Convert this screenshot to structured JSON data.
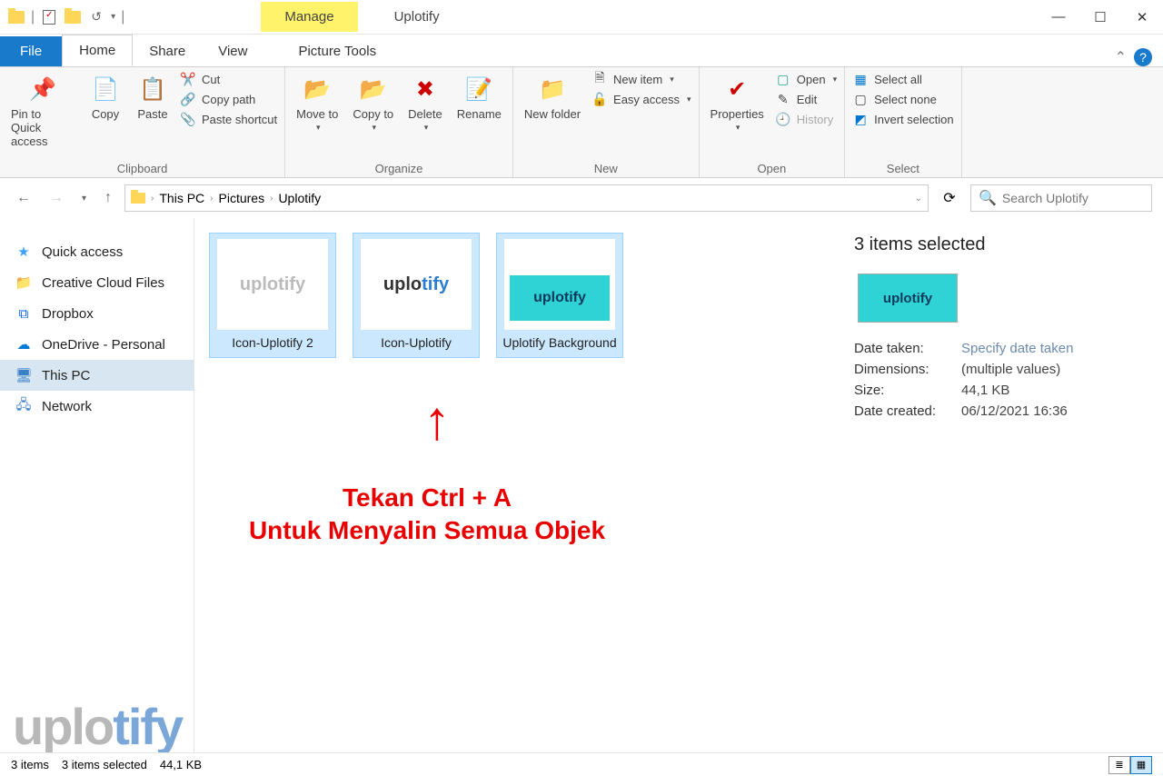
{
  "title": {
    "context_tab": "Manage",
    "window": "Uplotify",
    "tools_sub": "Picture Tools"
  },
  "tabs": {
    "file": "File",
    "home": "Home",
    "share": "Share",
    "view": "View"
  },
  "ribbon": {
    "clipboard": {
      "pin": "Pin to Quick access",
      "copy": "Copy",
      "paste": "Paste",
      "cut": "Cut",
      "copy_path": "Copy path",
      "paste_shortcut": "Paste shortcut",
      "label": "Clipboard"
    },
    "organize": {
      "move": "Move to",
      "copy_to": "Copy to",
      "delete": "Delete",
      "rename": "Rename",
      "label": "Organize"
    },
    "new": {
      "new_folder": "New folder",
      "new_item": "New item",
      "easy_access": "Easy access",
      "label": "New"
    },
    "open": {
      "properties": "Properties",
      "open": "Open",
      "edit": "Edit",
      "history": "History",
      "label": "Open"
    },
    "select": {
      "all": "Select all",
      "none": "Select none",
      "invert": "Invert selection",
      "label": "Select"
    }
  },
  "breadcrumbs": [
    "This PC",
    "Pictures",
    "Uplotify"
  ],
  "search": {
    "placeholder": "Search Uplotify"
  },
  "sidebar": [
    {
      "label": "Quick access",
      "icon": "★",
      "color": "#40A0FF"
    },
    {
      "label": "Creative Cloud Files",
      "icon": "📁",
      "color": "#FFB640"
    },
    {
      "label": "Dropbox",
      "icon": "⧈",
      "color": "#0061FF"
    },
    {
      "label": "OneDrive - Personal",
      "icon": "☁",
      "color": "#0078D4"
    },
    {
      "label": "This PC",
      "icon": "🖥",
      "color": "#3a80c7",
      "active": true
    },
    {
      "label": "Network",
      "icon": "🖧",
      "color": "#3a80c7"
    }
  ],
  "files": [
    {
      "name": "Icon-Uplotify 2",
      "style": "gray"
    },
    {
      "name": "Icon-Uplotify",
      "style": "blue"
    },
    {
      "name": "Uplotify Background",
      "style": "teal"
    }
  ],
  "details": {
    "heading": "3 items selected",
    "props": [
      {
        "k": "Date taken:",
        "v": "Specify date taken",
        "hint": true
      },
      {
        "k": "Dimensions:",
        "v": "(multiple values)"
      },
      {
        "k": "Size:",
        "v": "44,1 KB"
      },
      {
        "k": "Date created:",
        "v": "06/12/2021 16:36"
      }
    ]
  },
  "annotation": {
    "line1": "Tekan Ctrl + A",
    "line2": "Untuk Menyalin Semua Objek"
  },
  "status": {
    "items": "3 items",
    "selected": "3 items selected",
    "size": "44,1 KB"
  },
  "watermark": {
    "a": "uplo",
    "b": "tify"
  }
}
